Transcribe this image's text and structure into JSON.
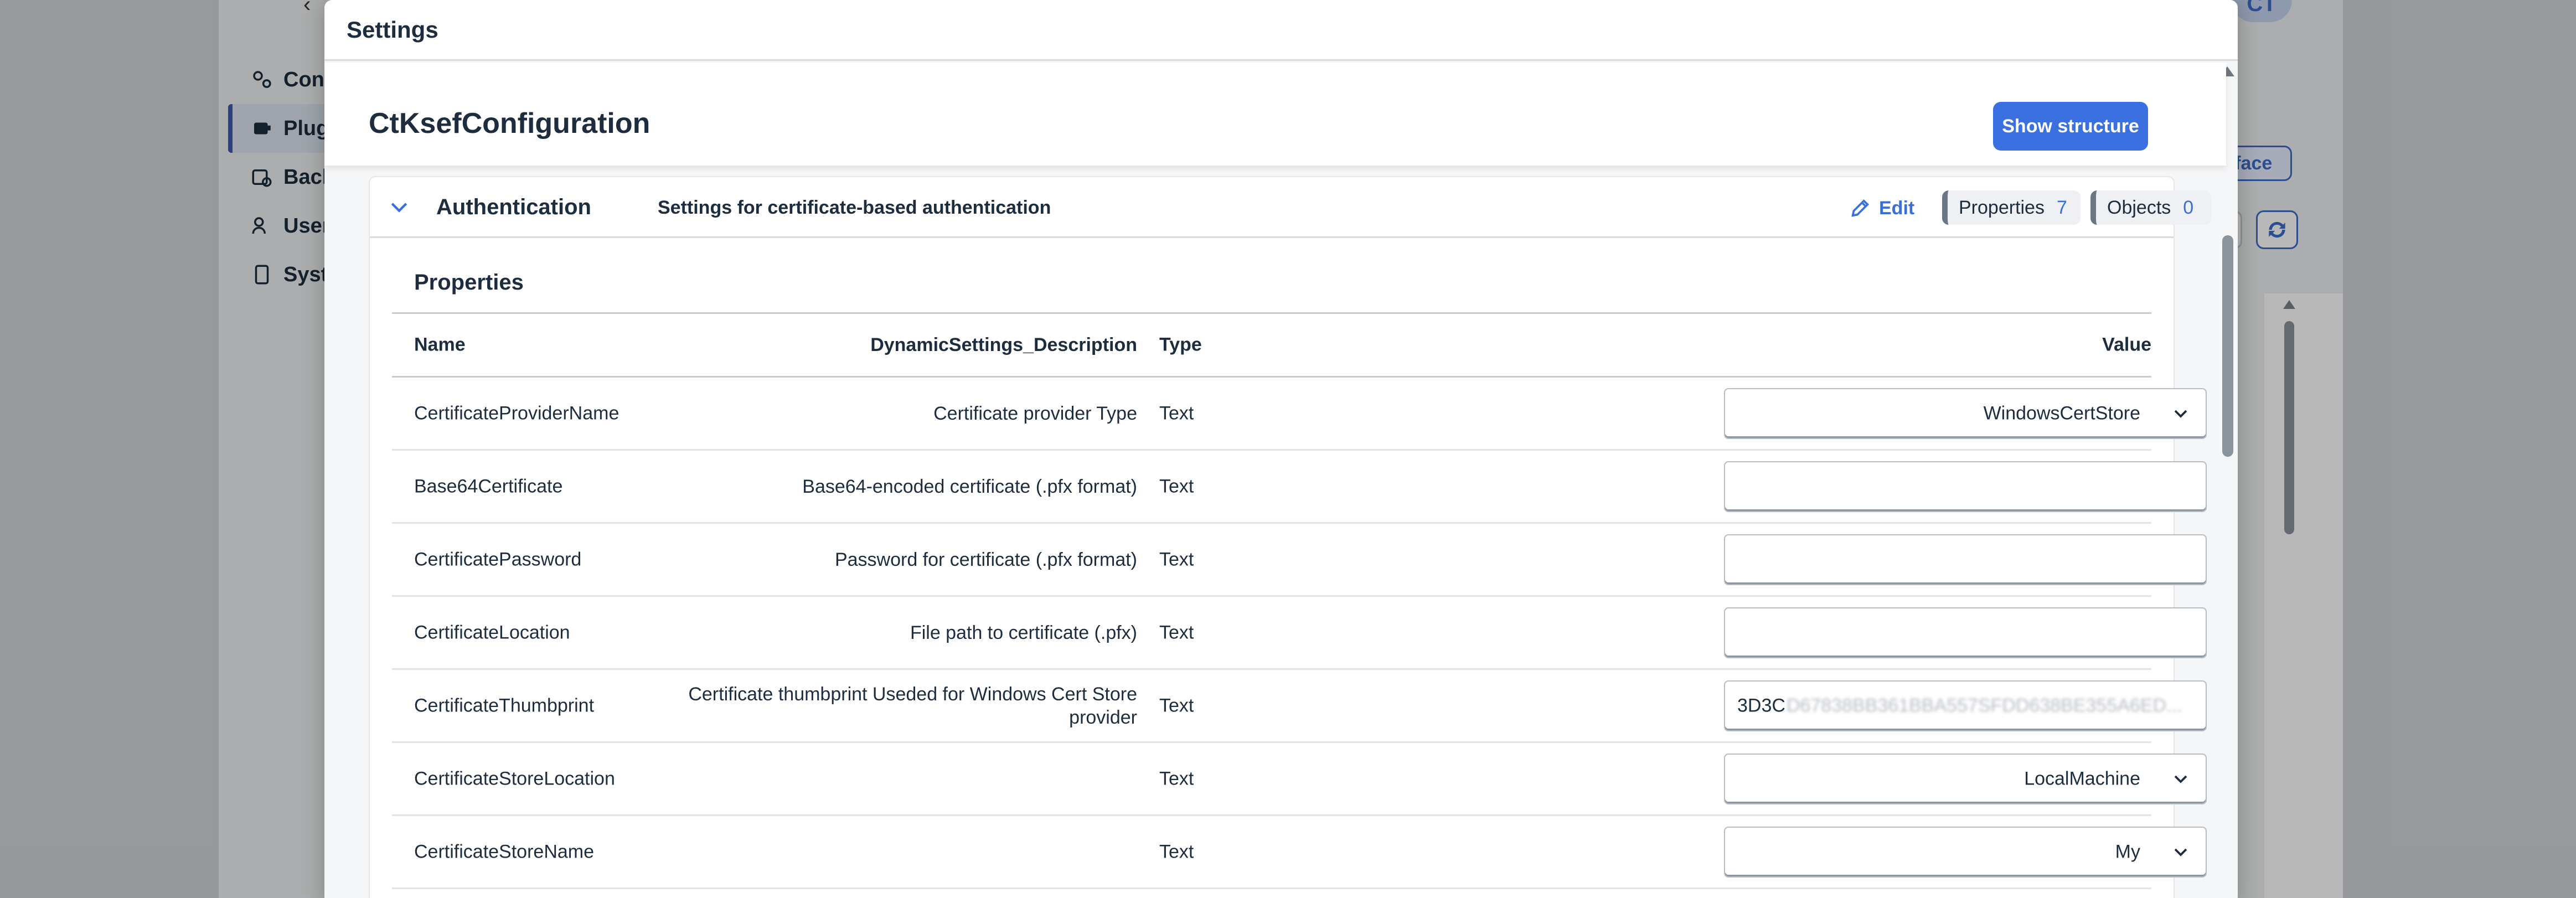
{
  "background": {
    "nav_items": [
      {
        "label": "Conf",
        "icon": "gears-icon"
      },
      {
        "label": "Plug",
        "icon": "plugin-icon"
      },
      {
        "label": "Back",
        "icon": "backup-icon"
      },
      {
        "label": "User",
        "icon": "users-icon"
      },
      {
        "label": "Syst",
        "icon": "device-icon"
      }
    ],
    "chip_label": "rface",
    "avatar_initials": "CT"
  },
  "dialog": {
    "title": "Settings",
    "page_title": "CtKsefConfiguration",
    "show_structure_label": "Show structure"
  },
  "section": {
    "title": "Authentication",
    "description": "Settings for certificate-based authentication",
    "edit_label": "Edit",
    "properties_tag": {
      "label": "Properties",
      "count": "7"
    },
    "objects_tag": {
      "label": "Objects",
      "count": "0"
    }
  },
  "properties": {
    "title": "Properties",
    "columns": {
      "name": "Name",
      "description": "DynamicSettings_Description",
      "type": "Type",
      "value": "Value"
    },
    "rows": [
      {
        "name": "CertificateProviderName",
        "description": "Certificate provider Type",
        "type": "Text",
        "value": "WindowsCertStore",
        "control": "select"
      },
      {
        "name": "Base64Certificate",
        "description": "Base64-encoded certificate (.pfx format)",
        "type": "Text",
        "value": "",
        "control": "text"
      },
      {
        "name": "CertificatePassword",
        "description": "Password for certificate (.pfx format)",
        "type": "Text",
        "value": "",
        "control": "text"
      },
      {
        "name": "CertificateLocation",
        "description": "File path to certificate (.pfx)",
        "type": "Text",
        "value": "",
        "control": "text"
      },
      {
        "name": "CertificateThumbprint",
        "description": "Certificate thumbprint Useded for Windows Cert Store provider",
        "type": "Text",
        "value": "3D3C",
        "value_blurred": "D67838BB361BBA557SFDD638BE355A6ED...",
        "control": "text"
      },
      {
        "name": "CertificateStoreLocation",
        "description": "",
        "type": "Text",
        "value": "LocalMachine",
        "control": "select"
      },
      {
        "name": "CertificateStoreName",
        "description": "",
        "type": "Text",
        "value": "My",
        "control": "select"
      }
    ]
  },
  "colors": {
    "accent": "#3a70e0",
    "link": "#3a6fd8",
    "text": "#1d2d3e"
  }
}
